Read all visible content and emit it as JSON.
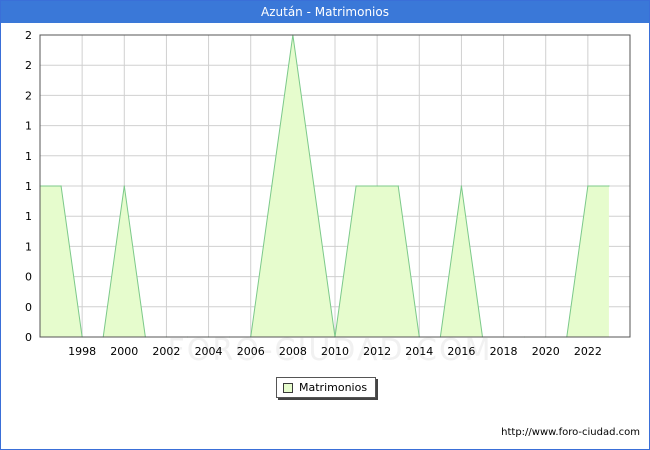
{
  "title": "Azután - Matrimonios",
  "watermark": "FORO-CIUDAD.COM",
  "footer": "http://www.foro-ciudad.com",
  "colors": {
    "titlebar": "#3a78d8",
    "fill": "#e6fccd",
    "line": "#7cc98a",
    "grid": "#d0d0d0"
  },
  "chart_data": {
    "type": "area",
    "legend": [
      "Matrimonios"
    ],
    "legend_placement": "bottom-center",
    "grid": true,
    "x": [
      1996,
      1997,
      1998,
      1999,
      2000,
      2001,
      2002,
      2003,
      2004,
      2005,
      2006,
      2007,
      2008,
      2009,
      2010,
      2011,
      2012,
      2013,
      2014,
      2015,
      2016,
      2017,
      2018,
      2019,
      2020,
      2021,
      2022,
      2023
    ],
    "series": [
      {
        "name": "Matrimonios",
        "values": [
          1,
          1,
          0,
          0,
          1,
          0,
          0,
          0,
          0,
          0,
          0,
          1,
          2,
          1,
          0,
          1,
          1,
          1,
          0,
          0,
          1,
          0,
          0,
          0,
          0,
          0,
          1,
          1
        ]
      }
    ],
    "xlim": [
      1996,
      2024
    ],
    "ylim": [
      0,
      2
    ],
    "x_ticks": [
      1998,
      2000,
      2002,
      2004,
      2006,
      2008,
      2010,
      2012,
      2014,
      2016,
      2018,
      2020,
      2022
    ],
    "y_tick_values": [
      0,
      0.2,
      0.4,
      0.6,
      0.8,
      1,
      1.2,
      1.4,
      1.6,
      1.8,
      2
    ],
    "y_tick_labels": [
      "0",
      "0",
      "0",
      "1",
      "1",
      "1",
      "1",
      "1",
      "2",
      "2",
      "2"
    ]
  }
}
